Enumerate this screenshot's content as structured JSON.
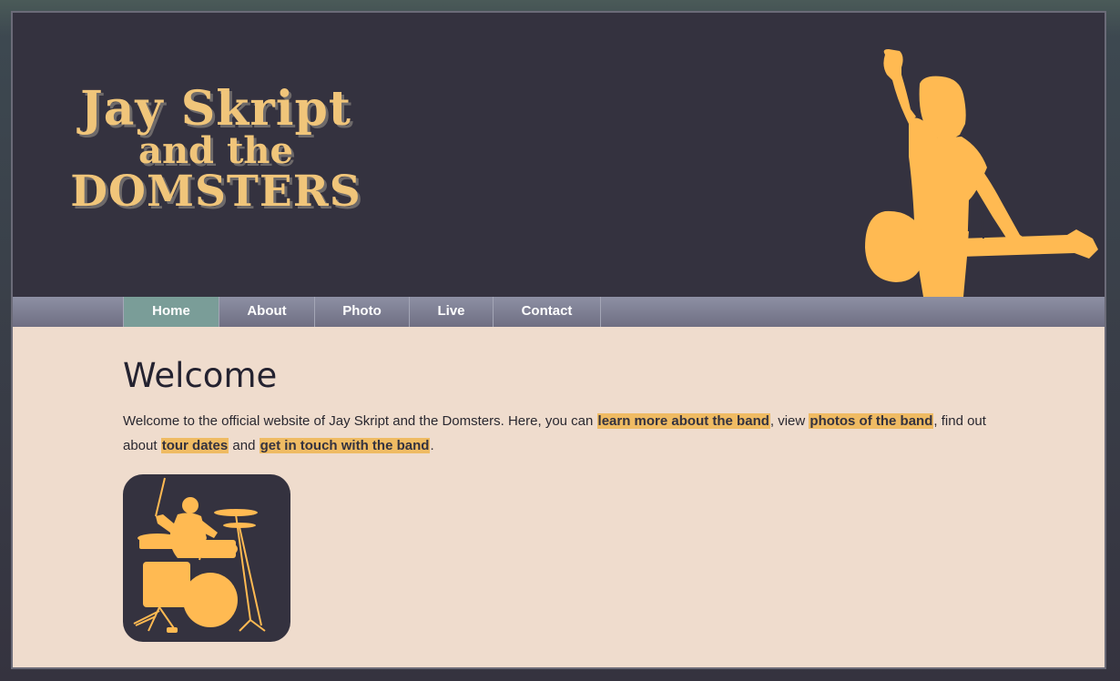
{
  "header": {
    "logo_line1": "Jay Skript",
    "logo_line2": "and the",
    "logo_line3": "DOMSTERS"
  },
  "nav": {
    "items": [
      {
        "label": "Home",
        "active": true
      },
      {
        "label": "About",
        "active": false
      },
      {
        "label": "Photo",
        "active": false
      },
      {
        "label": "Live",
        "active": false
      },
      {
        "label": "Contact",
        "active": false
      }
    ]
  },
  "main": {
    "heading": "Welcome",
    "intro_1": "Welcome to the official website of Jay Skript and the Domsters. Here, you can ",
    "link_about": "learn more about the band",
    "intro_2": ", view ",
    "link_photos": "photos of the band",
    "intro_3": ", find out about ",
    "link_tours": "tour dates",
    "intro_4": " and ",
    "link_contact": "get in touch with the band",
    "intro_5": "."
  },
  "colors": {
    "header_bg": "#34323f",
    "accent": "#ffba52",
    "content_bg": "#efdccd",
    "nav_active": "#7a9d98"
  },
  "icons": {
    "header_art": "guitarist-silhouette",
    "content_image": "drummer-silhouette"
  }
}
